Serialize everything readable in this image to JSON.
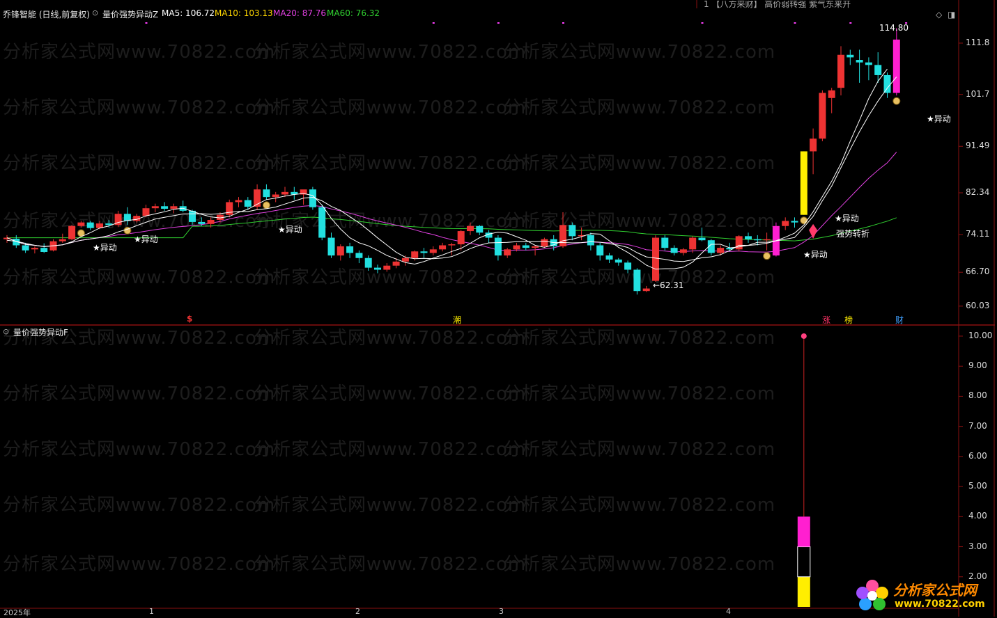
{
  "main_header": {
    "title": "乔锋智能 (日线,前复权)",
    "indicator": "量价强势异动Z",
    "ma5": "MA5: 106.72",
    "ma10": "MA10: 103.13",
    "ma20": "MA20: 87.76",
    "ma60": "MA60: 76.32"
  },
  "ticker_text": "1  【八方来财】 高价弱转强   紫气东来开",
  "sub_header": {
    "indicator": "量价强势异动F"
  },
  "colors": {
    "ma5": "#ffffff",
    "ma10": "#ffd700",
    "ma20": "#e040e0",
    "ma60": "#30d030",
    "up": "#ee3333",
    "down": "#22e0e0",
    "accent_yellow": "#ffee00",
    "accent_magenta": "#ff1fd0"
  },
  "chart_data": [
    {
      "type": "candlestick",
      "title": "",
      "ylim": [
        57,
        117
      ],
      "y_ticks": [
        "111.8",
        "101.7",
        "91.49",
        "82.34",
        "74.11",
        "66.70",
        "60.03"
      ],
      "x_labels": [
        "2025年",
        "1",
        "2",
        "3",
        "4"
      ],
      "annotations": {
        "high_label": "114.80",
        "low_label": "←62.31",
        "signals": [
          "★异动",
          "★异动",
          "★异动",
          "★异动",
          "★异动",
          "★异动",
          "强势转折"
        ],
        "markers": [
          "$",
          "潮",
          "涨",
          "榜",
          "财"
        ]
      },
      "ohlc": [
        [
          73.2,
          74.0,
          72.5,
          73.5
        ],
        [
          73.3,
          74.0,
          71.5,
          72.0
        ],
        [
          72.0,
          72.5,
          70.5,
          71.0
        ],
        [
          71.2,
          71.8,
          70.4,
          71.5
        ],
        [
          71.5,
          72.4,
          70.5,
          70.7
        ],
        [
          71.0,
          73.2,
          70.8,
          72.8
        ],
        [
          72.8,
          74.3,
          72.5,
          73.2
        ],
        [
          73.2,
          76.0,
          73.0,
          75.8
        ],
        [
          75.8,
          76.8,
          75.5,
          76.5
        ],
        [
          76.5,
          76.8,
          75.0,
          75.4
        ],
        [
          75.4,
          76.8,
          75.2,
          76.3
        ],
        [
          76.3,
          77.0,
          75.5,
          76.0
        ],
        [
          76.0,
          78.8,
          75.6,
          78.2
        ],
        [
          78.2,
          79.5,
          76.0,
          76.8
        ],
        [
          76.8,
          78.2,
          76.5,
          77.8
        ],
        [
          77.8,
          80.0,
          77.5,
          79.3
        ],
        [
          79.3,
          80.2,
          78.5,
          79.7
        ],
        [
          79.7,
          80.5,
          78.8,
          79.2
        ],
        [
          79.2,
          80.2,
          78.3,
          79.7
        ],
        [
          79.7,
          80.8,
          78.5,
          78.8
        ],
        [
          78.8,
          79.0,
          76.0,
          76.6
        ],
        [
          76.6,
          77.5,
          75.8,
          76.2
        ],
        [
          76.2,
          77.5,
          75.5,
          77.0
        ],
        [
          77.0,
          78.5,
          76.5,
          78.0
        ],
        [
          78.0,
          81.0,
          77.5,
          80.5
        ],
        [
          80.5,
          81.5,
          79.5,
          80.9
        ],
        [
          80.9,
          81.5,
          79.0,
          79.6
        ],
        [
          79.6,
          84.0,
          79.0,
          83.0
        ],
        [
          83.0,
          84.0,
          81.0,
          81.5
        ],
        [
          81.5,
          82.5,
          80.5,
          82.0
        ],
        [
          82.0,
          83.5,
          81.5,
          82.5
        ],
        [
          82.5,
          83.5,
          81.0,
          82.0
        ],
        [
          82.0,
          82.8,
          80.0,
          83.0
        ],
        [
          83.0,
          83.5,
          79.0,
          79.5
        ],
        [
          79.5,
          80.0,
          73.0,
          73.5
        ],
        [
          73.5,
          74.5,
          69.5,
          70.0
        ],
        [
          70.0,
          72.2,
          69.0,
          71.8
        ],
        [
          71.8,
          72.5,
          69.5,
          70.5
        ],
        [
          70.5,
          71.0,
          68.5,
          69.5
        ],
        [
          69.5,
          70.0,
          67.0,
          67.6
        ],
        [
          67.6,
          68.2,
          66.5,
          67.2
        ],
        [
          67.2,
          68.5,
          66.8,
          68.0
        ],
        [
          68.0,
          69.5,
          67.5,
          68.8
        ],
        [
          68.8,
          70.0,
          68.0,
          69.5
        ],
        [
          69.5,
          71.0,
          69.0,
          70.8
        ],
        [
          70.8,
          71.5,
          69.5,
          70.5
        ],
        [
          70.5,
          71.8,
          70.0,
          71.2
        ],
        [
          71.2,
          72.5,
          70.8,
          72.0
        ],
        [
          72.0,
          72.5,
          70.0,
          72.2
        ],
        [
          72.2,
          75.0,
          71.0,
          74.8
        ],
        [
          74.8,
          76.5,
          74.0,
          75.8
        ],
        [
          75.8,
          76.0,
          74.0,
          74.5
        ],
        [
          74.5,
          75.0,
          72.5,
          73.5
        ],
        [
          73.5,
          74.0,
          69.0,
          70.0
        ],
        [
          70.0,
          71.5,
          69.5,
          71.2
        ],
        [
          71.2,
          72.5,
          70.8,
          72.0
        ],
        [
          72.0,
          72.5,
          71.0,
          71.5
        ],
        [
          71.5,
          72.0,
          70.0,
          71.8
        ],
        [
          71.8,
          73.5,
          71.5,
          73.2
        ],
        [
          73.2,
          74.0,
          71.0,
          71.8
        ],
        [
          71.8,
          78.5,
          71.5,
          76.0
        ],
        [
          76.0,
          76.5,
          73.0,
          73.8
        ],
        [
          73.8,
          75.5,
          73.0,
          74.0
        ],
        [
          74.0,
          74.5,
          71.0,
          72.0
        ],
        [
          72.0,
          72.5,
          69.0,
          70.0
        ],
        [
          70.0,
          70.5,
          68.5,
          69.2
        ],
        [
          69.2,
          69.5,
          68.0,
          68.6
        ],
        [
          68.6,
          69.0,
          66.5,
          67.2
        ],
        [
          67.2,
          67.5,
          62.31,
          63.0
        ],
        [
          63.0,
          64.0,
          62.8,
          63.5
        ],
        [
          65.0,
          74.0,
          64.8,
          73.5
        ],
        [
          73.5,
          74.0,
          71.0,
          71.5
        ],
        [
          71.5,
          72.0,
          70.0,
          70.5
        ],
        [
          70.5,
          71.5,
          70.0,
          71.2
        ],
        [
          71.2,
          73.8,
          70.5,
          73.5
        ],
        [
          73.5,
          75.5,
          72.8,
          73.0
        ],
        [
          73.0,
          73.2,
          70.0,
          70.5
        ],
        [
          70.5,
          72.0,
          70.0,
          71.5
        ],
        [
          71.5,
          72.5,
          70.8,
          71.2
        ],
        [
          71.2,
          74.0,
          70.8,
          73.8
        ],
        [
          73.8,
          74.5,
          72.5,
          73.2
        ],
        [
          73.2,
          74.0,
          72.0,
          73.0
        ],
        [
          73.0,
          74.5,
          71.0,
          73.2
        ],
        [
          70.0,
          76.5,
          69.8,
          75.8
        ],
        [
          75.8,
          77.5,
          75.0,
          76.8
        ],
        [
          76.8,
          77.5,
          75.5,
          76.5
        ],
        [
          78.0,
          90.5,
          78.0,
          90.5
        ],
        [
          90.5,
          95.0,
          86.0,
          93.0
        ],
        [
          93.0,
          102.5,
          92.5,
          102.0
        ],
        [
          101.0,
          103.0,
          98.0,
          102.5
        ],
        [
          103.0,
          111.2,
          101.5,
          109.5
        ],
        [
          109.5,
          110.5,
          107.5,
          109.0
        ],
        [
          108.5,
          110.5,
          104.0,
          108.0
        ],
        [
          108.0,
          109.0,
          104.5,
          107.5
        ],
        [
          107.5,
          110.0,
          104.0,
          105.5
        ],
        [
          105.5,
          106.0,
          101.0,
          102.0
        ],
        [
          102.0,
          114.8,
          101.5,
          112.5
        ]
      ],
      "ma5": [
        73.0,
        72.8,
        72.4,
        72.0,
        71.8,
        71.9,
        72.1,
        72.7,
        73.7,
        74.5,
        75.4,
        75.8,
        76.5,
        76.9,
        77.1,
        77.8,
        78.2,
        78.6,
        79.1,
        79.3,
        78.7,
        78.1,
        77.6,
        77.4,
        77.7,
        78.5,
        79.1,
        80.1,
        81.0,
        81.3,
        81.7,
        82.0,
        82.2,
        81.8,
        79.9,
        77.3,
        75.2,
        73.5,
        72.5,
        71.9,
        71.0,
        70.0,
        69.3,
        68.6,
        68.3,
        68.8,
        69.5,
        70.1,
        70.8,
        71.4,
        72.4,
        73.5,
        74.2,
        74.6,
        74.4,
        73.7,
        73.0,
        72.0,
        71.6,
        72.1,
        72.9,
        73.2,
        73.7,
        74.3,
        74.2,
        72.9,
        71.6,
        70.6,
        69.4,
        68.1,
        67.3,
        67.4,
        67.4,
        67.7,
        68.7,
        70.5,
        72.2,
        72.2,
        71.5,
        71.7,
        72.0,
        72.6,
        72.6,
        72.9,
        73.6,
        74.4,
        76.0,
        78.6,
        81.6,
        84.6,
        88.1,
        92.5,
        96.6,
        100.9,
        104.3,
        106.7
      ]
    },
    {
      "type": "bar",
      "title": "",
      "ylim": [
        1,
        10.3
      ],
      "y_ticks": [
        "10.00",
        "9.00",
        "8.00",
        "7.00",
        "6.00",
        "5.00",
        "4.00",
        "3.00",
        "2.00"
      ],
      "segments": [
        {
          "from": 1,
          "to": 2.0,
          "color": "yellow"
        },
        {
          "from": 2.0,
          "to": 3.0,
          "color": "black"
        },
        {
          "from": 3.0,
          "to": 4.0,
          "color": "magenta"
        }
      ],
      "line_top": 10.0,
      "outline_top": 4.0
    }
  ],
  "watermark": {
    "text": "分析家公式网www.70822.com"
  },
  "logo": {
    "line1": "分析家公式网",
    "line2": "www.70822.com"
  }
}
